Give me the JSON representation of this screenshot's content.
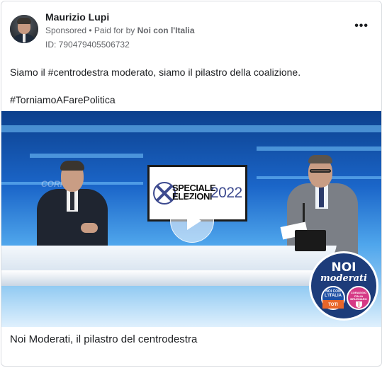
{
  "post": {
    "author": "Maurizio Lupi",
    "sponsored": "Sponsored",
    "separator": " • ",
    "paid_for_by": "Paid for by ",
    "payer": "Noi con l'Italia",
    "ad_id": "ID: 790479405506732",
    "more_icon": "more-horizontal-icon",
    "text": "Siamo il #centrodestra moderato, siamo il pilastro della coalizione.",
    "hashtag": "#TorniamoAFarePolitica",
    "caption": "Noi Moderati, il pilastro del centrodestra"
  },
  "video": {
    "screen_line1": "SPECIALE",
    "screen_line2": "ELEZIONI",
    "screen_year": "2022",
    "background_word": "CORR",
    "play_icon": "play-icon"
  },
  "logo": {
    "title": "NOI",
    "subtitle": "moderati",
    "left_top": "NOI CON",
    "left_mid": "L'ITALIA",
    "left_bottom": "TOTI",
    "right_top": "CORAGGIO ITALIA",
    "right_bottom": "BRUGNARO"
  },
  "colors": {
    "text": "#1c1e21",
    "secondary": "#65676b",
    "border": "#dadde1",
    "logo_blue": "#1d3c7a",
    "logo_pink": "#d63a86"
  }
}
